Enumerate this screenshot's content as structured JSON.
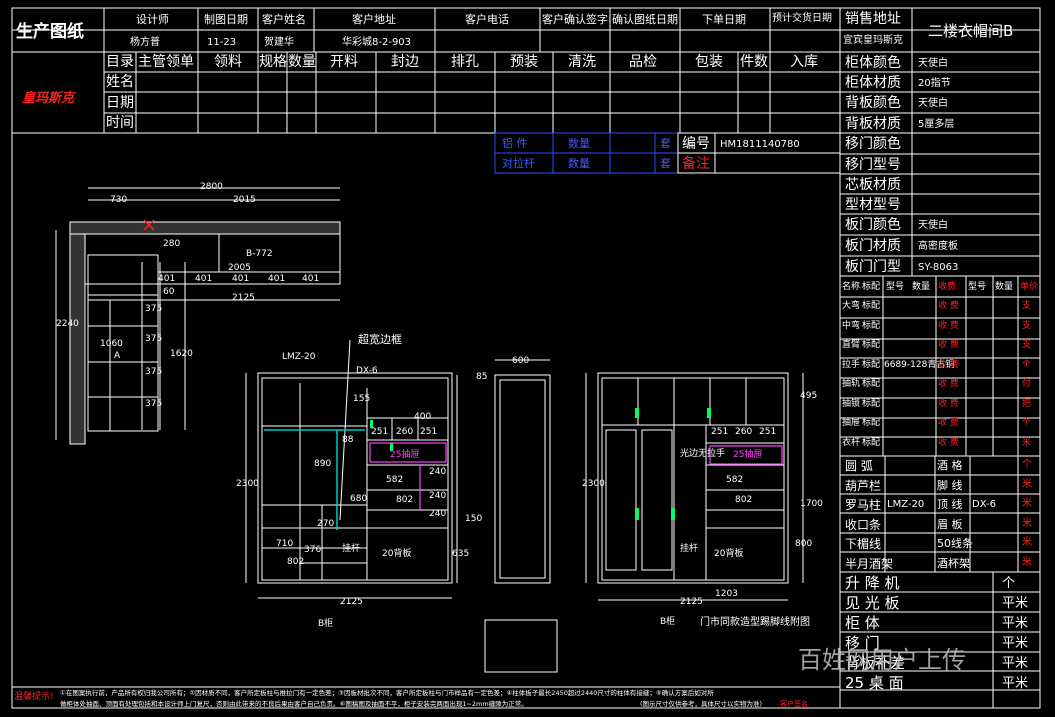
{
  "header": {
    "title": "生产图纸",
    "cols": [
      "设计师",
      "制图日期",
      "客户姓名",
      "客户地址",
      "客户电话",
      "客户确认签字",
      "确认图纸日期",
      "下单日期",
      "预计交货日期"
    ],
    "values": [
      "杨方普",
      "11-23",
      "贺建华",
      "华彩城8-2-903"
    ],
    "sales_addr_label": "销售地址",
    "sales_addr": "宜宾皇玛斯克",
    "room": "二楼衣帽间B"
  },
  "logo": "皇玛斯克",
  "process": {
    "row_labels": [
      "目录",
      "姓名",
      "日期",
      "时间"
    ],
    "cols": [
      "主管领单",
      "领料",
      "规格",
      "数量",
      "开料",
      "封边",
      "排孔",
      "预装",
      "清洗",
      "品检",
      "包装",
      "件数",
      "入库"
    ]
  },
  "hardware": {
    "r1": [
      "铝  件",
      "数量",
      "套"
    ],
    "r2": [
      "对拉杆",
      "数量",
      "套"
    ],
    "code_label": "编号",
    "code": "HM1811140780",
    "note_label": "备注"
  },
  "specs": [
    {
      "k": "柜体颜色",
      "v": "天使白"
    },
    {
      "k": "柜体材质",
      "v": "20指节"
    },
    {
      "k": "背板颜色",
      "v": "天使白"
    },
    {
      "k": "背板材质",
      "v": "5厘多层"
    },
    {
      "k": "移门颜色",
      "v": ""
    },
    {
      "k": "移门型号",
      "v": ""
    },
    {
      "k": "芯板材质",
      "v": ""
    },
    {
      "k": "型材型号",
      "v": ""
    },
    {
      "k": "板门颜色",
      "v": "天使白"
    },
    {
      "k": "板门材质",
      "v": "高密度板"
    },
    {
      "k": "板门门型",
      "v": "SY-8063"
    }
  ],
  "parts_header": [
    "名称",
    "标配",
    "型号",
    "数量",
    "收费",
    "型号",
    "数量",
    "单价"
  ],
  "parts": [
    {
      "n": "大弯",
      "c": "标配",
      "m": "",
      "fee": "收 费",
      "u": "支"
    },
    {
      "n": "中弯",
      "c": "标配",
      "m": "",
      "fee": "收 费",
      "u": "支"
    },
    {
      "n": "直臂",
      "c": "标配",
      "m": "",
      "fee": "收 费",
      "u": "支"
    },
    {
      "n": "拉手",
      "c": "标配",
      "m": "6689-128青古铜",
      "fee": "收 费",
      "u": "个"
    },
    {
      "n": "抽轨",
      "c": "标配",
      "m": "",
      "fee": "收 费",
      "u": "付"
    },
    {
      "n": "抽锁",
      "c": "标配",
      "m": "",
      "fee": "收 费",
      "u": "把"
    },
    {
      "n": "抽屉",
      "c": "标配",
      "m": "",
      "fee": "收 费",
      "u": "个"
    },
    {
      "n": "衣杆",
      "c": "标配",
      "m": "",
      "fee": "收 费",
      "u": "米"
    }
  ],
  "trim": [
    {
      "a": "圆  弧",
      "b": "",
      "c": "酒  格",
      "d": "",
      "u": "个"
    },
    {
      "a": "葫芦栏",
      "b": "",
      "c": "脚  线",
      "d": "",
      "u": "米"
    },
    {
      "a": "罗马柱",
      "b": "LMZ-20",
      "c": "顶  线",
      "d": "DX-6",
      "u": "米"
    },
    {
      "a": "收口条",
      "b": "",
      "c": "眉  板",
      "d": "",
      "u": "米"
    },
    {
      "a": "下楣线",
      "b": "",
      "c": "50线条",
      "d": "",
      "u": "米"
    },
    {
      "a": "半月酒架",
      "b": "",
      "c": "酒杯架",
      "d": "",
      "u": "米"
    }
  ],
  "units": [
    {
      "k": "升 降 机",
      "u": "个"
    },
    {
      "k": "见 光 板",
      "u": "平米"
    },
    {
      "k": "柜    体",
      "u": "平米"
    },
    {
      "k": "移    门",
      "u": "平米"
    },
    {
      "k": "背板补差",
      "u": "平米"
    },
    {
      "k": "25 桌 面",
      "u": "平米"
    }
  ],
  "plan": {
    "d": [
      "2800",
      "730",
      "2015",
      "B-772",
      "280",
      "2005",
      "401",
      "401",
      "401",
      "401",
      "401",
      "2125",
      "2240",
      "1060",
      "375",
      "375",
      "375",
      "375",
      "1620",
      "60",
      "A"
    ]
  },
  "elev_b": {
    "labels": [
      "LMZ-20",
      "超宽边框",
      "DX-6",
      "155",
      "400",
      "88",
      "251",
      "260",
      "251",
      "25抽屉",
      "582",
      "802",
      "890",
      "680",
      "270",
      "376",
      "802",
      "710",
      "240",
      "240",
      "240",
      "挂杆",
      "20背板",
      "2300",
      "2125",
      "B柜"
    ]
  },
  "side": {
    "labels": [
      "600",
      "85",
      "150",
      "635"
    ]
  },
  "elev_c": {
    "labels": [
      "495",
      "251",
      "260",
      "251",
      "25抽屉",
      "582",
      "802",
      "1700",
      "800",
      "2300",
      "20背板",
      "挂杆",
      "1203",
      "2125",
      "B柜",
      "门市同款造型踢脚线附图",
      "光边无拉手"
    ]
  },
  "footer": {
    "warn": "温馨提示!",
    "line1": "①在图案执行前，产品所有权归我公司所有；②因材质不同，客户所定板柱与推拉门有一定色差；③因板材批次不同，客户所定板柱与门市样品有一定色差；④柱体板子最长2450超过2440尺寸的柱体有接缝；⑤确认方案后如对所",
    "line2": "做柜体处抽面、顶面有处理包括和本设计师上门复尺，否则由此带来的不良后果由客户自己负责。⑥图稿图及抽面不平，柜子安装完两面出现1~2mm缝隙为正常。",
    "note": "(图示尺寸仅供参考，具体尺寸以实物为准)",
    "ack": "客户签名"
  },
  "watermark": "百姓网用户上传"
}
